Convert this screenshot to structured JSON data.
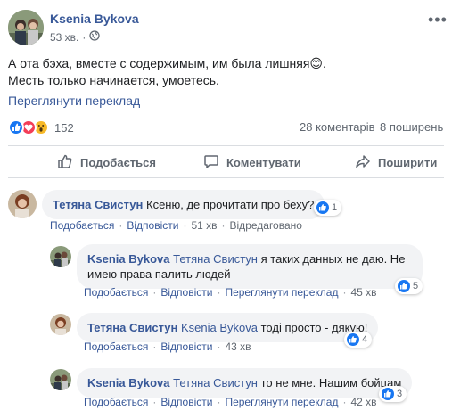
{
  "post": {
    "author": "Ksenia Bykova",
    "time": "53 хв.",
    "text_line1": "А ота бэха, вместе с содержимым, им была лишняя😊.",
    "text_line2": "Месть только начинается, умоетесь.",
    "see_translation": "Переглянути переклад",
    "reactions_count": "152",
    "comments_count": "28 коментарів",
    "shares_count": "8 поширень",
    "more_icon": "•••"
  },
  "actions": {
    "like": "Подобається",
    "comment": "Коментувати",
    "share": "Поширити"
  },
  "comments": [
    {
      "author": "Тетяна Свистун",
      "mention": "",
      "text": "Ксеню, де прочитати про беху?",
      "likes": "1",
      "like_label": "Подобається",
      "reply_label": "Відповісти",
      "time": "51 хв",
      "extra": "Відредаговано",
      "sep": "·"
    },
    {
      "author": "Ksenia Bykova",
      "mention": "Тетяна Свистун",
      "text_line1": "я таких данных не даю. Не",
      "text_line2": "имею права палить людей",
      "likes": "5",
      "like_label": "Подобається",
      "reply_label": "Відповісти",
      "translation_label": "Переглянути переклад",
      "time": "45 хв",
      "sep": "·"
    },
    {
      "author": "Тетяна Свистун",
      "mention": "Ksenia Bykova",
      "text": "тоді просто - дякую!",
      "likes": "4",
      "like_label": "Подобається",
      "reply_label": "Відповісти",
      "time": "43 хв",
      "sep": "·"
    },
    {
      "author": "Ksenia Bykova",
      "mention": "Тетяна Свистун",
      "text": "то не мне. Нашим бойцам",
      "likes": "3",
      "like_label": "Подобається",
      "reply_label": "Відповісти",
      "translation_label": "Переглянути переклад",
      "time": "42 хв",
      "sep": "·"
    }
  ],
  "colors": {
    "link": "#385898",
    "secondary": "#606770",
    "like_blue": "#1877f2",
    "love_red": "#f33e58",
    "wow_yellow": "#f7b928"
  }
}
